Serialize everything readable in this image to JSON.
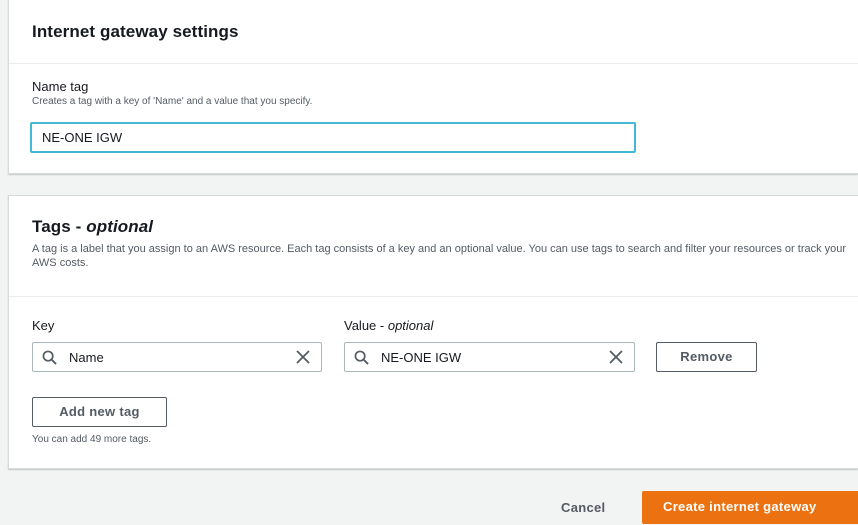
{
  "settings_panel": {
    "title": "Internet gateway settings",
    "name_tag": {
      "label": "Name tag",
      "description": "Creates a tag with a key of 'Name' and a value that you specify.",
      "value": "NE-ONE IGW"
    }
  },
  "tags_panel": {
    "title": "Tags - ",
    "title_optional": "optional",
    "description": "A tag is a label that you assign to an AWS resource. Each tag consists of a key and an optional value. You can use tags to search and filter your resources or track your AWS costs.",
    "key_label": "Key",
    "value_label": "Value - ",
    "value_label_optional": "optional",
    "tags": [
      {
        "key": "Name",
        "value": "NE-ONE IGW"
      }
    ],
    "remove_label": "Remove",
    "add_new_tag_label": "Add new tag",
    "remaining_hint": "You can add 49 more tags."
  },
  "footer": {
    "cancel_label": "Cancel",
    "create_label": "Create internet gateway"
  },
  "colors": {
    "primary": "#ec7211",
    "focus_border": "#44b9d6",
    "background": "#f2f3f3"
  },
  "icons": {
    "search": "search-icon",
    "clear": "close-icon"
  }
}
